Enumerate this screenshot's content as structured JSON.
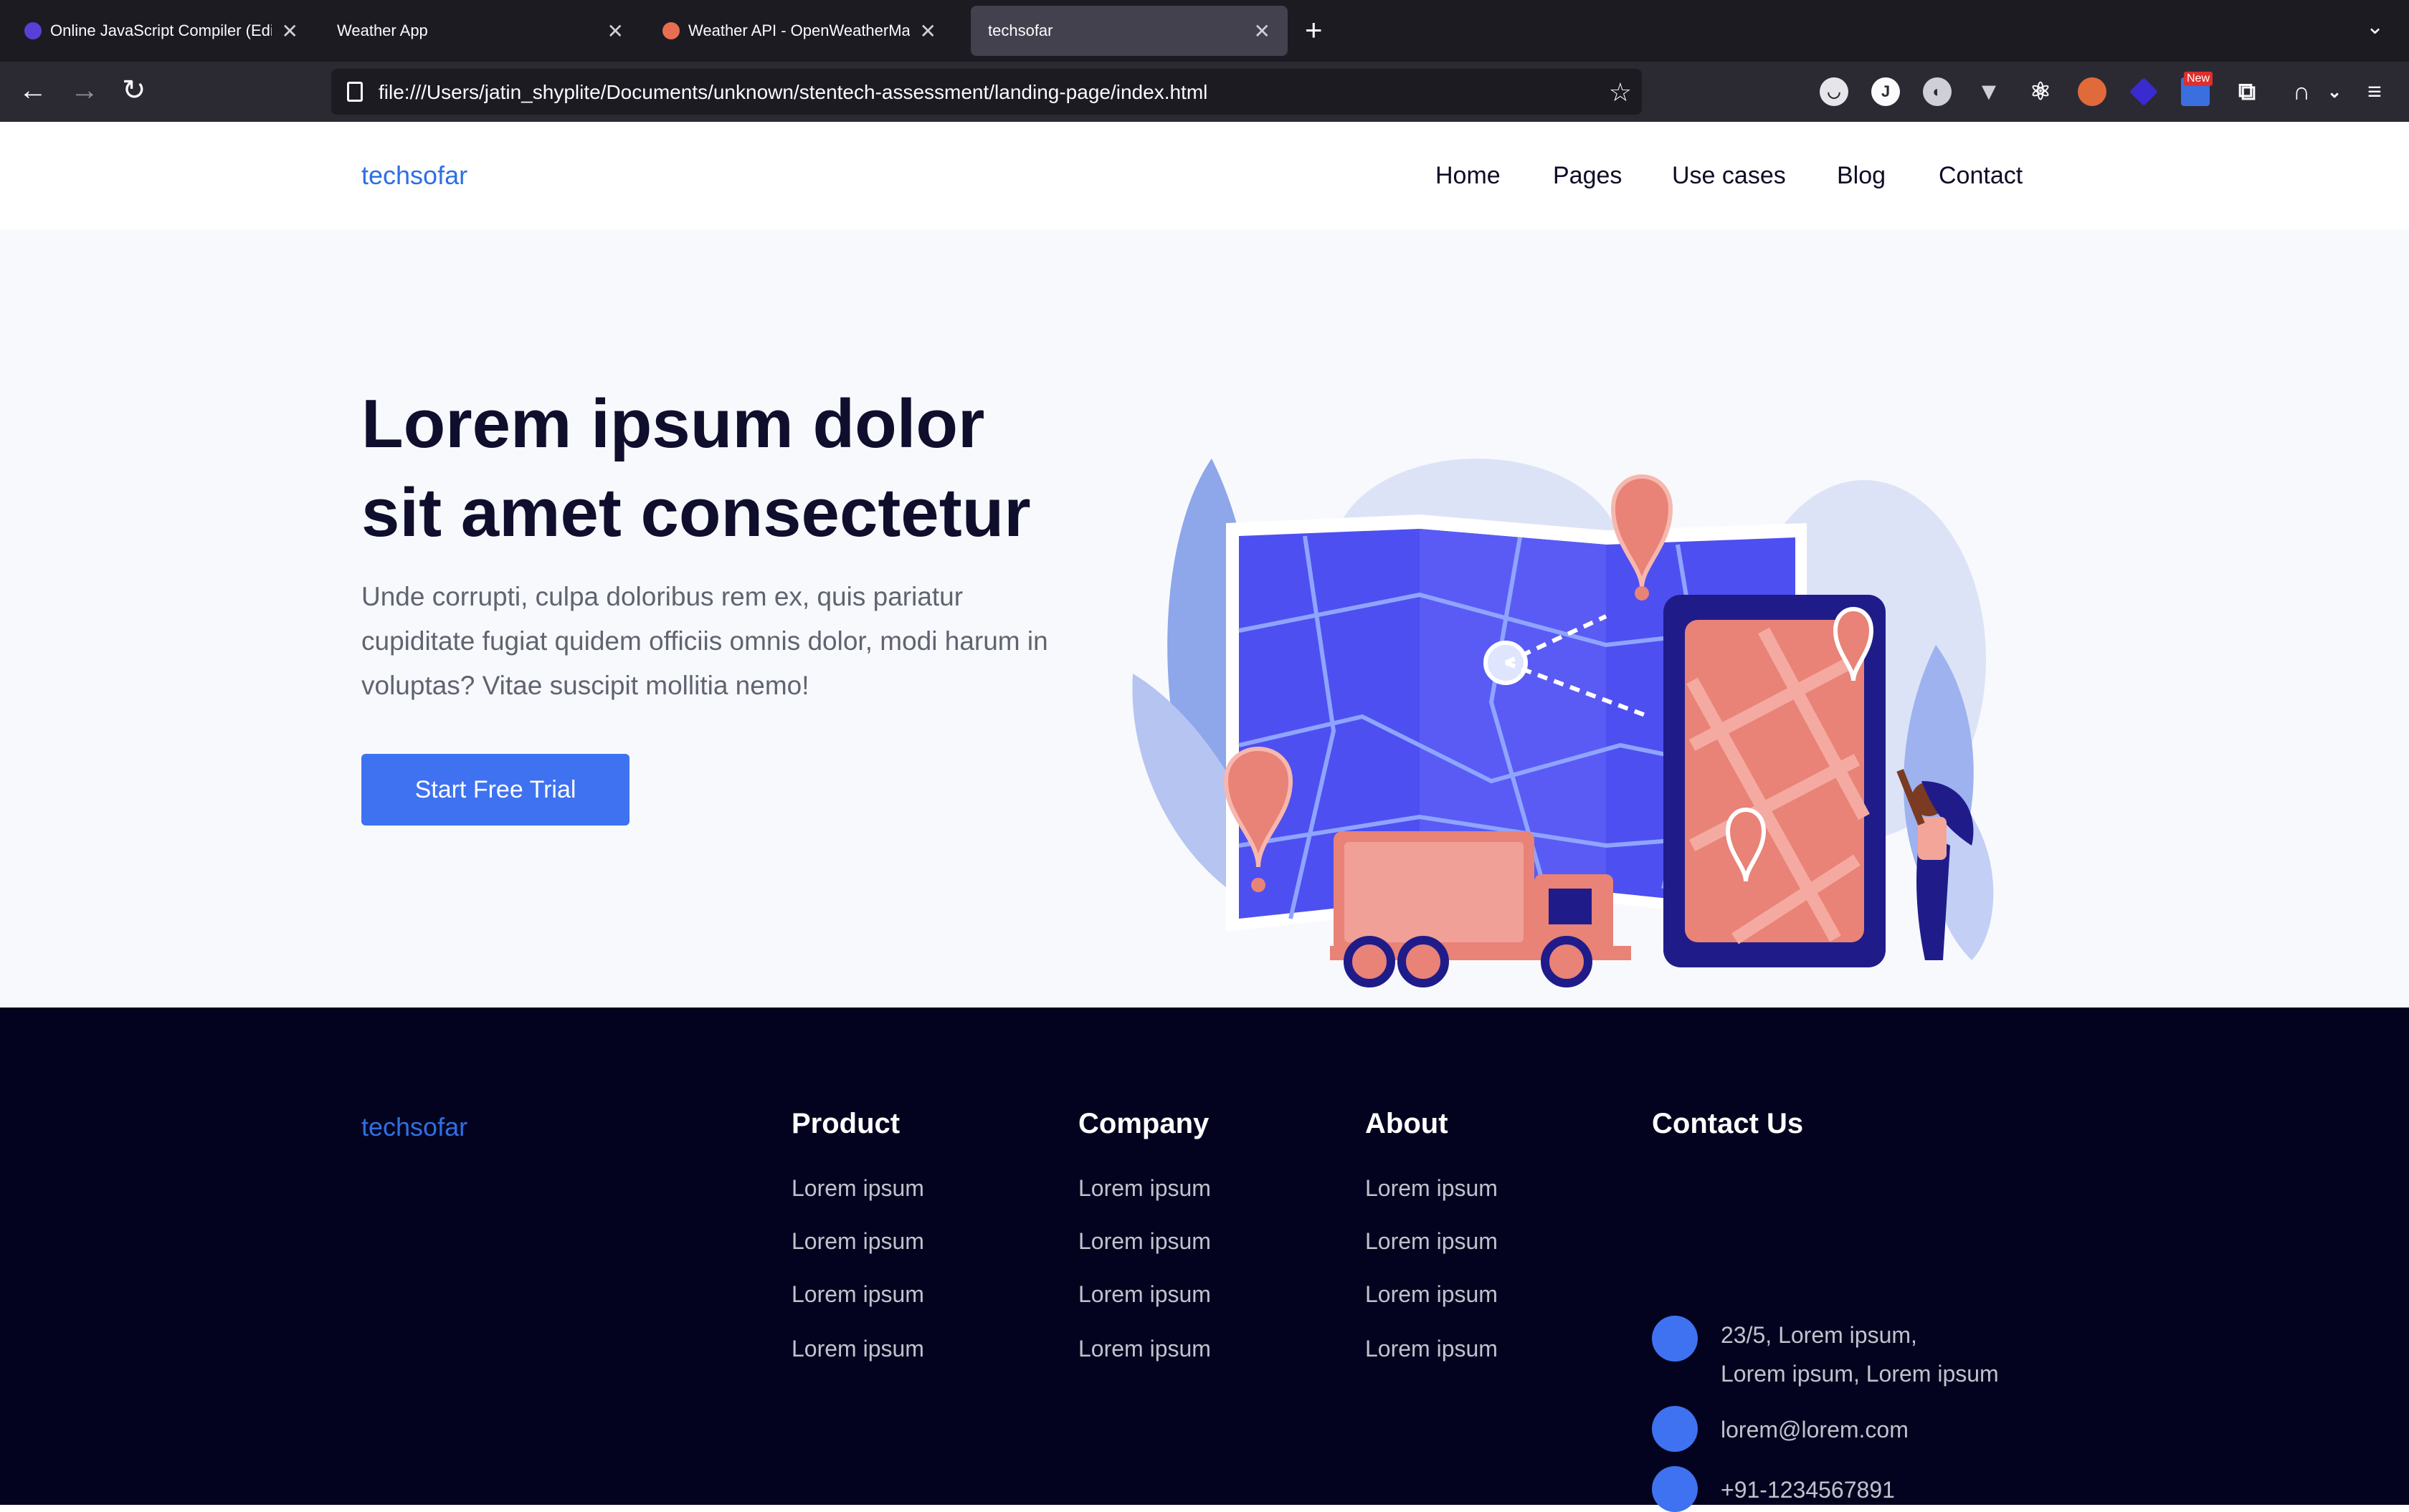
{
  "browser": {
    "tabs": [
      {
        "title": "Online JavaScript Compiler (Edi",
        "icon": "programiz-icon",
        "active": false
      },
      {
        "title": "Weather App",
        "icon": "",
        "active": false
      },
      {
        "title": "Weather API - OpenWeatherMa",
        "icon": "openweather-icon",
        "active": false
      },
      {
        "title": "techsofar",
        "icon": "",
        "active": true
      }
    ],
    "url": "file:///Users/jatin_shyplite/Documents/unknown/stentech-assessment/landing-page/index.html",
    "extensions": [
      "pocket-icon",
      "j-icon",
      "sun-icon",
      "vue-icon",
      "react-icon",
      "fox-icon",
      "stack-icon",
      "flag-icon",
      "puzzle-icon",
      "headphones-icon"
    ],
    "new_badge": "New"
  },
  "nav": {
    "logo": "techsofar",
    "links": [
      "Home",
      "Pages",
      "Use cases",
      "Blog",
      "Contact"
    ]
  },
  "hero": {
    "title": "Lorem ipsum dolor sit amet consectetur",
    "description": "Unde corrupti, culpa doloribus rem ex, quis pariatur cupiditate fugiat quidem officiis omnis dolor, modi harum in voluptas? Vitae suscipit mollitia nemo!",
    "cta": "Start Free Trial"
  },
  "footer": {
    "logo": "techsofar",
    "columns": [
      {
        "heading": "Product",
        "links": [
          "Lorem ipsum",
          "Lorem ipsum",
          "Lorem ipsum",
          "Lorem ipsum"
        ]
      },
      {
        "heading": "Company",
        "links": [
          "Lorem ipsum",
          "Lorem ipsum",
          "Lorem ipsum",
          "Lorem ipsum"
        ]
      },
      {
        "heading": "About",
        "links": [
          "Lorem ipsum",
          "Lorem ipsum",
          "Lorem ipsum",
          "Lorem ipsum"
        ]
      }
    ],
    "contact": {
      "heading": "Contact Us",
      "address_line1": "23/5, Lorem ipsum,",
      "address_line2": "Lorem ipsum, Lorem ipsum",
      "email": "lorem@lorem.com",
      "phone": "+91-1234567891"
    }
  },
  "colors": {
    "brand": "#3f72f0",
    "footer_bg": "#04031f",
    "hero_bg": "#f7f9fc"
  }
}
